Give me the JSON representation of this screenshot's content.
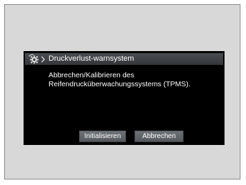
{
  "dialog": {
    "breadcrumb_icon": "gear-icon",
    "separator_icon": "chevron-right-icon",
    "title": "Druckverlust-warnsystem",
    "message_line1": "Abbrechen/Kalibrieren des",
    "message_line2": "Reifendrucküberwachungssystems (TPMS).",
    "buttons": {
      "initialize_label": "Initialisieren",
      "cancel_label": "Abbrechen"
    }
  },
  "colors": {
    "screen_background": "#000000",
    "title_bar": "#3e4145",
    "button": "#63666a",
    "text": "#ffffff",
    "outer_frame": "#d8d8d8"
  }
}
